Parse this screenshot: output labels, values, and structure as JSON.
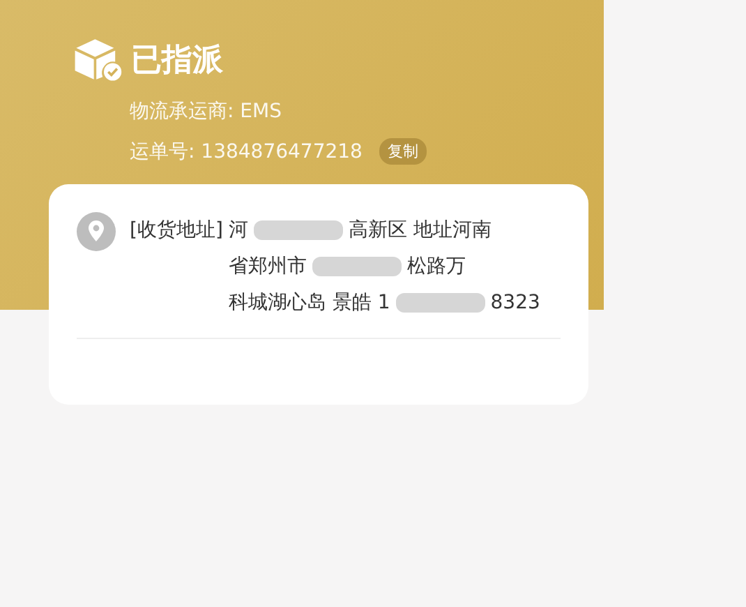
{
  "status": {
    "title": "已指派",
    "carrier": "物流承运商: EMS",
    "tracking": "运单号: 1384876477218",
    "copy_button": "复制"
  },
  "address": {
    "label": "[收货地址]",
    "lines": [
      {
        "segments": [
          "河",
          "高新区 地址河南"
        ]
      },
      {
        "segments": [
          "省郑州市",
          "松路万"
        ]
      },
      {
        "segments": [
          "科城湖心岛 景皓 1",
          "8323"
        ]
      }
    ]
  }
}
